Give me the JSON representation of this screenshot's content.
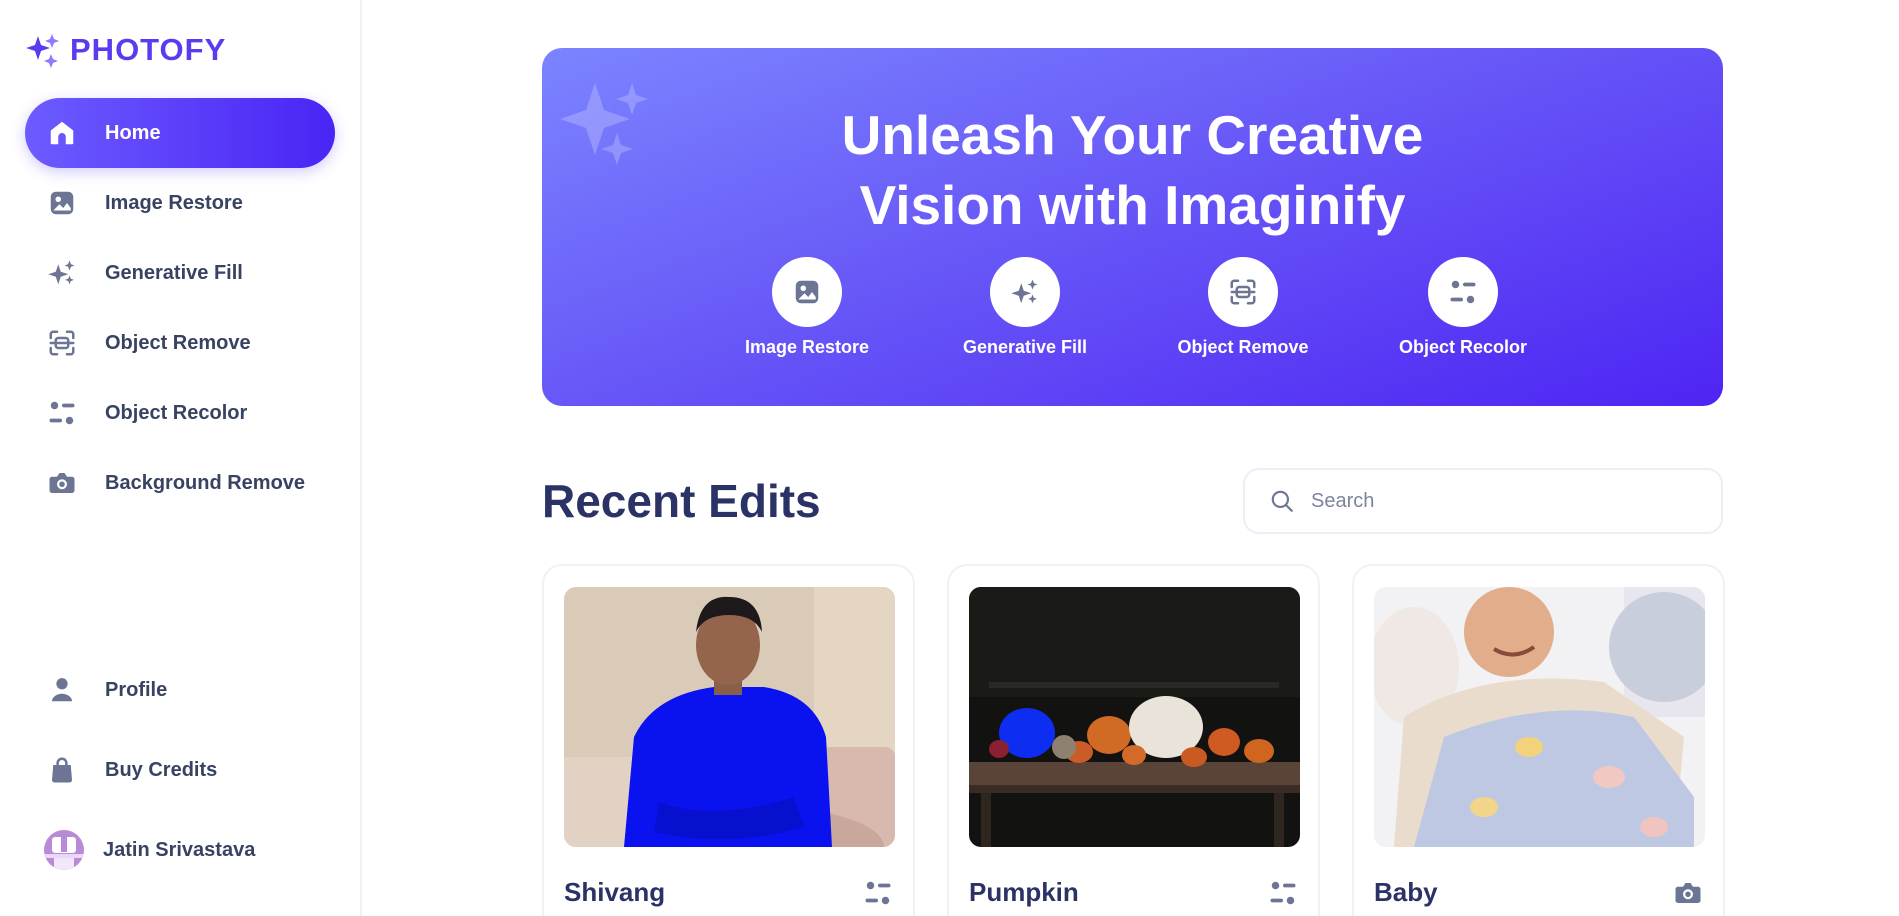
{
  "app": {
    "name": "PHOTOFY",
    "brand_color": "#5b3bf0",
    "accent_gradient": [
      "#6c5cff",
      "#4a24f5"
    ]
  },
  "sidebar": {
    "items": [
      {
        "label": "Home",
        "icon": "home-icon",
        "active": true
      },
      {
        "label": "Image Restore",
        "icon": "image-icon"
      },
      {
        "label": "Generative Fill",
        "icon": "sparkles-icon"
      },
      {
        "label": "Object Remove",
        "icon": "scan-icon"
      },
      {
        "label": "Object Recolor",
        "icon": "filter-icon"
      },
      {
        "label": "Background Remove",
        "icon": "camera-icon"
      }
    ],
    "bottom_items": [
      {
        "label": "Profile",
        "icon": "user-icon"
      },
      {
        "label": "Buy Credits",
        "icon": "shopping-bag-icon"
      }
    ],
    "user": {
      "name": "Jatin Srivastava"
    }
  },
  "hero": {
    "title_line1": "Unleash Your Creative",
    "title_line2": "Vision with Imaginify",
    "features": [
      {
        "label": "Image Restore",
        "icon": "image-icon"
      },
      {
        "label": "Generative Fill",
        "icon": "sparkles-icon"
      },
      {
        "label": "Object Remove",
        "icon": "scan-icon"
      },
      {
        "label": "Object Recolor",
        "icon": "filter-icon"
      }
    ]
  },
  "recent": {
    "title": "Recent Edits",
    "search_placeholder": "Search",
    "cards": [
      {
        "title": "Shivang",
        "icon": "filter-icon"
      },
      {
        "title": "Pumpkin",
        "icon": "filter-icon"
      },
      {
        "title": "Baby",
        "icon": "camera-icon"
      }
    ]
  }
}
